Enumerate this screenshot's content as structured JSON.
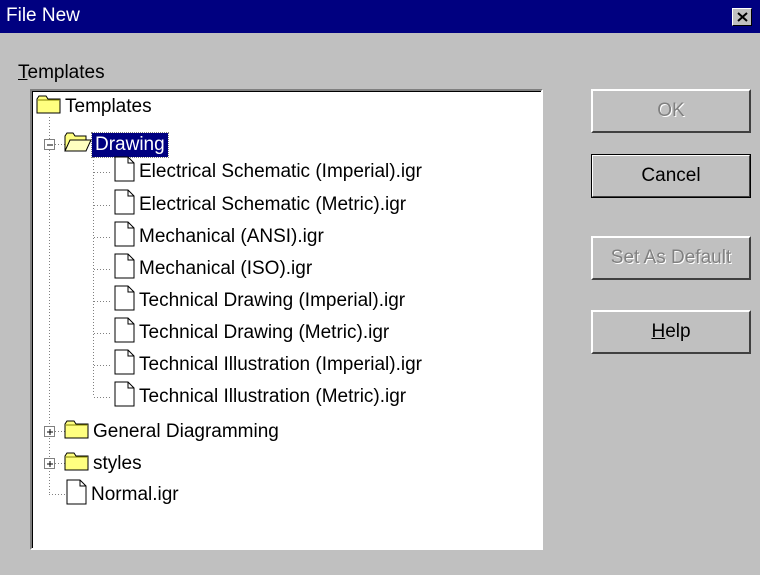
{
  "window": {
    "title": "File New"
  },
  "templates_label": {
    "accel": "T",
    "rest": "emplates"
  },
  "tree": {
    "root": "Templates",
    "drawing": "Drawing",
    "drawing_files": [
      "Electrical Schematic (Imperial).igr",
      "Electrical Schematic (Metric).igr",
      "Mechanical (ANSI).igr",
      "Mechanical (ISO).igr",
      "Technical Drawing (Imperial).igr",
      "Technical Drawing (Metric).igr",
      "Technical Illustration (Imperial).igr",
      "Technical Illustration (Metric).igr"
    ],
    "general": "General Diagramming",
    "styles": "styles",
    "normal": "Normal.igr"
  },
  "buttons": {
    "ok": "OK",
    "cancel": "Cancel",
    "set_default": "Set As Default",
    "help_accel": "H",
    "help_rest": "elp"
  },
  "colors": {
    "title_bar": "#000080",
    "selection": "#000080",
    "face": "#c0c0c0",
    "folder": "#ffff80"
  },
  "icons": {
    "folder": "folder-icon",
    "open_folder": "open-folder-icon",
    "document": "document-icon",
    "expand": "plus-box-icon",
    "collapse": "minus-box-icon"
  }
}
